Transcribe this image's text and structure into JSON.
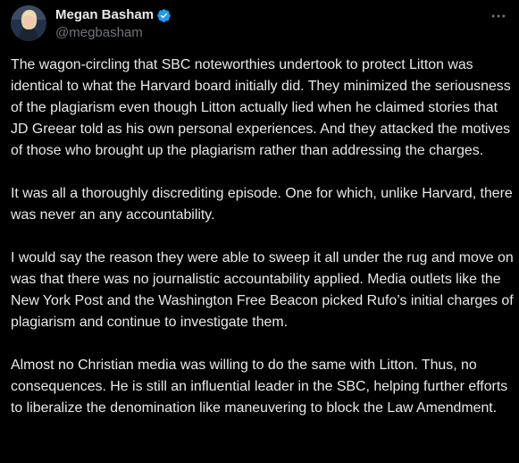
{
  "author": {
    "display_name": "Megan Basham",
    "handle": "@megbasham",
    "verified": true,
    "verified_color": "#1d9bf0"
  },
  "icons": {
    "verified": "verified-badge-icon",
    "more": "more-horizontal-icon"
  },
  "post": {
    "paragraphs": [
      "The wagon-circling that SBC noteworthies undertook to protect Litton was identical to what the Harvard board initially did. They minimized the seriousness of the plagiarism even though Litton actually lied when he claimed stories that JD Greear told as his own personal experiences. And they attacked the motives of those who brought up the plagiarism rather than addressing the charges.",
      "It was all a thoroughly discrediting episode. One for which, unlike Harvard, there was never an any accountability.",
      "I would say the reason they were able to sweep it all under the rug and move on was that there was no journalistic accountability applied. Media outlets like the New York Post and the Washington Free Beacon picked Rufo’s initial charges of plagiarism and continue to investigate them.",
      "Almost no Christian media was willing to do the same with Litton. Thus, no consequences. He is still an influential leader in the SBC, helping further efforts to liberalize the denomination like maneuvering to block the Law Amendment."
    ]
  },
  "colors": {
    "background": "#000000",
    "text": "#e7e9ea",
    "secondary_text": "#71767b",
    "accent": "#1d9bf0"
  }
}
